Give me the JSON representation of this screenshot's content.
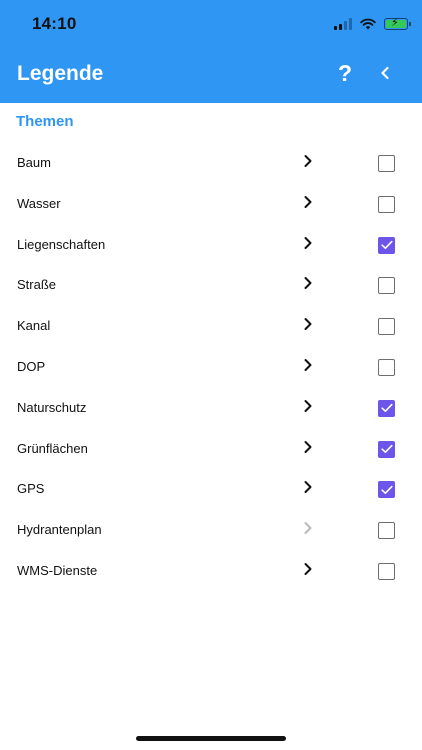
{
  "status_bar": {
    "time": "14:10"
  },
  "nav": {
    "title": "Legende",
    "help_icon": "question-mark-icon",
    "back_icon": "chevron-left-icon"
  },
  "section": {
    "title": "Themen"
  },
  "colors": {
    "header": "#2F96F3",
    "accent": "#2F96F3",
    "checkbox_checked": "#6C55E8",
    "chevron_disabled": "#b8b8b8"
  },
  "items": [
    {
      "label": "Baum",
      "checked": false,
      "chevron_enabled": true
    },
    {
      "label": "Wasser",
      "checked": false,
      "chevron_enabled": true
    },
    {
      "label": "Liegenschaften",
      "checked": true,
      "chevron_enabled": true
    },
    {
      "label": "Straße",
      "checked": false,
      "chevron_enabled": true
    },
    {
      "label": "Kanal",
      "checked": false,
      "chevron_enabled": true
    },
    {
      "label": "DOP",
      "checked": false,
      "chevron_enabled": true
    },
    {
      "label": "Naturschutz",
      "checked": true,
      "chevron_enabled": true
    },
    {
      "label": "Grünflächen",
      "checked": true,
      "chevron_enabled": true
    },
    {
      "label": "GPS",
      "checked": true,
      "chevron_enabled": true
    },
    {
      "label": "Hydrantenplan",
      "checked": false,
      "chevron_enabled": false
    },
    {
      "label": "WMS-Dienste",
      "checked": false,
      "chevron_enabled": true
    }
  ]
}
